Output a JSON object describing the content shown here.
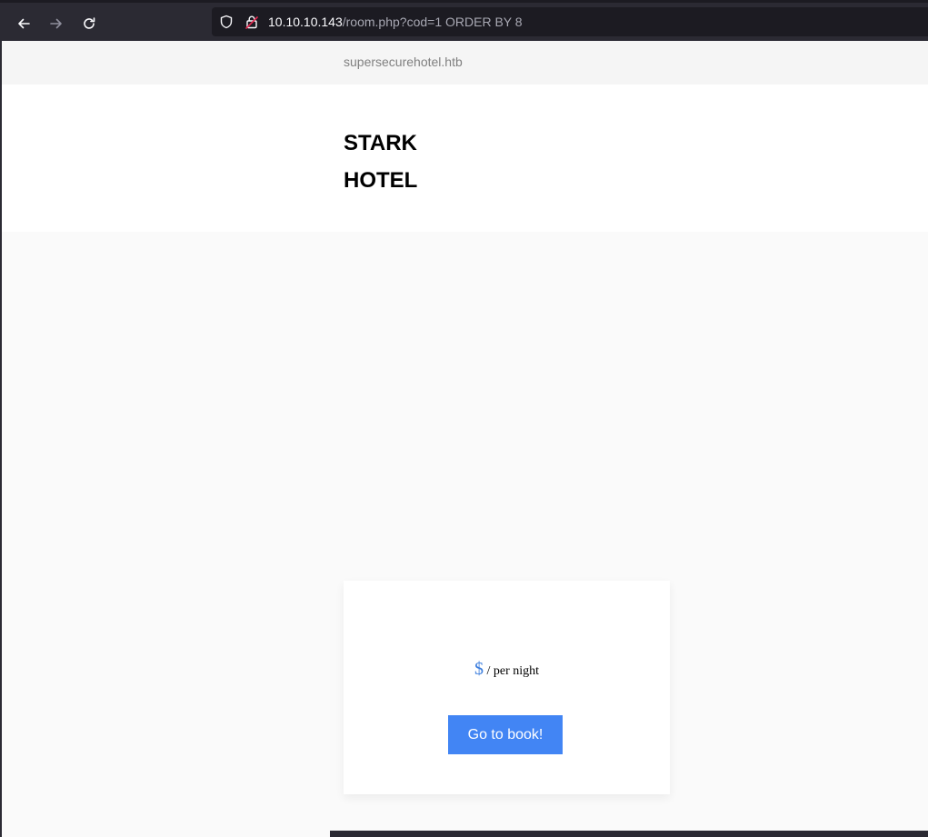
{
  "browser": {
    "url_host": "10.10.10.143",
    "url_path": "/room.php?cod=1 ORDER BY 8"
  },
  "site": {
    "topbar_link": "supersecurehotel.htb",
    "brand_line1": "STARK",
    "brand_line2": "HOTEL"
  },
  "room_card": {
    "currency": "$",
    "price_suffix": "/ per night",
    "book_button": "Go to book!"
  },
  "colors": {
    "toolbar_bg": "#2b2a33",
    "urlbar_bg": "#1c1b22",
    "button_blue": "#4285f4",
    "currency_blue": "#3b7ddd",
    "page_bg": "#fafafa"
  }
}
